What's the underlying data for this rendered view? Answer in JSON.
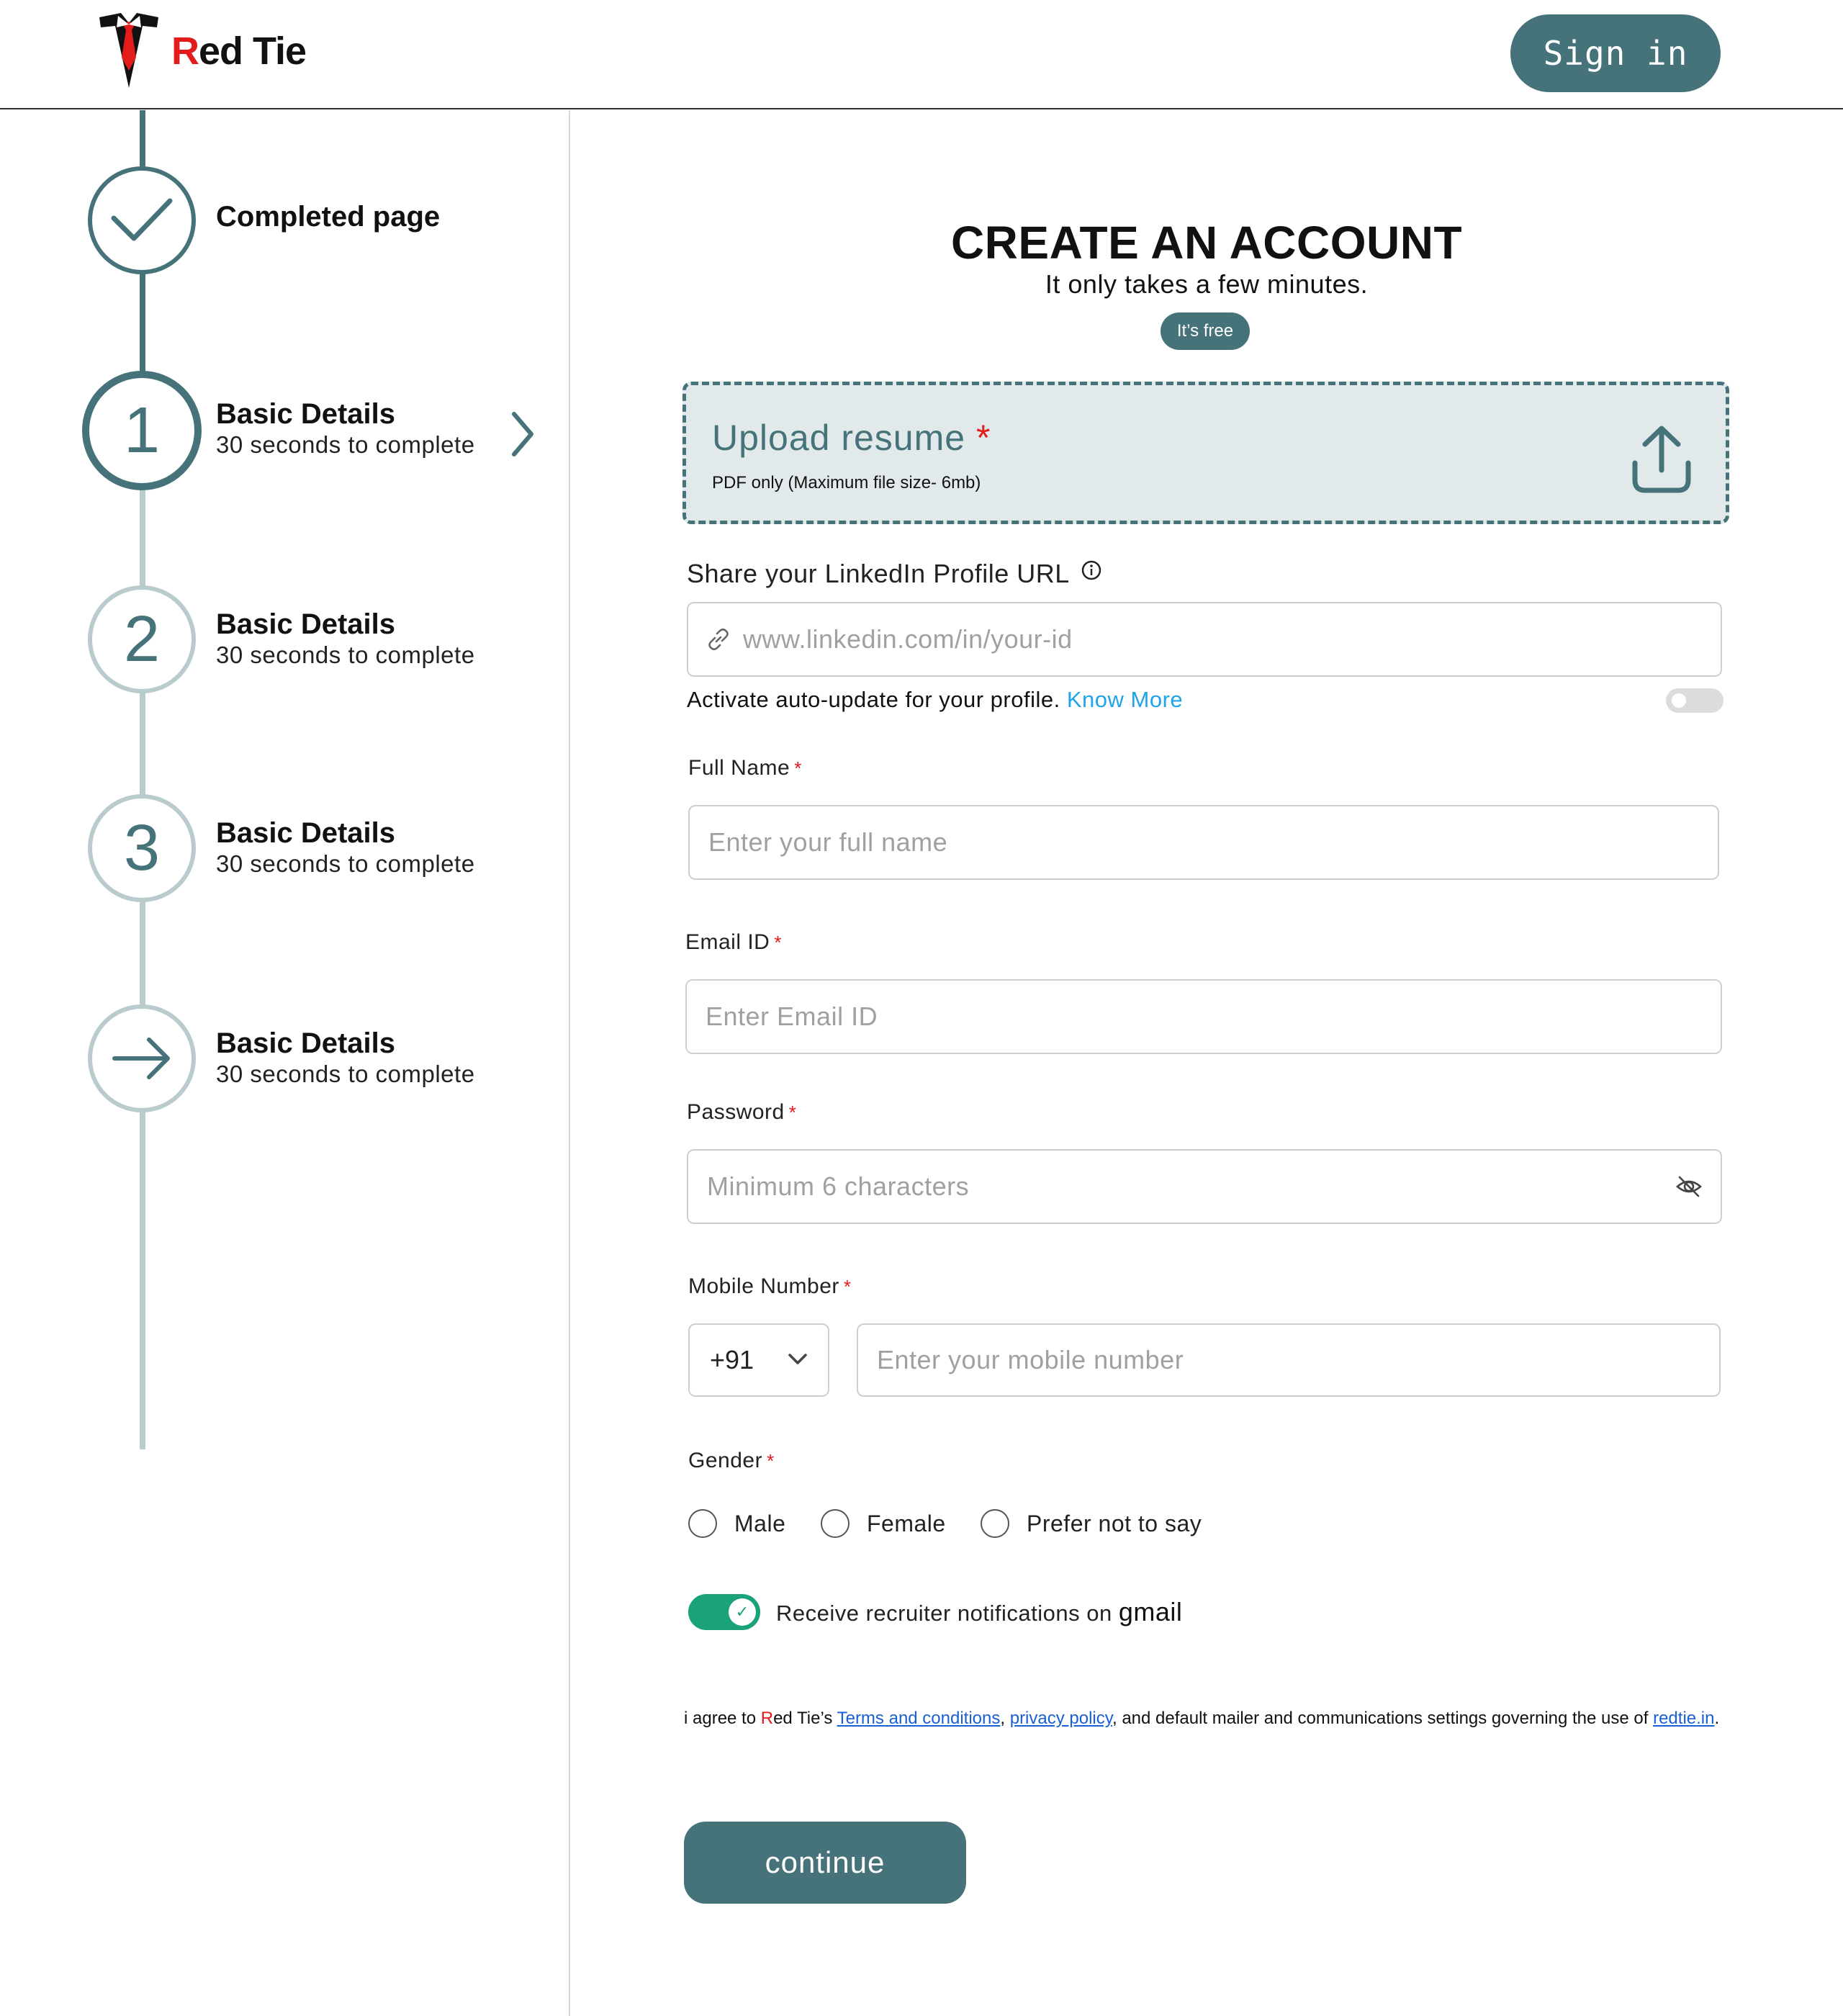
{
  "header": {
    "logo_text_accent": "R",
    "logo_text_rest": "ed Tie",
    "signin_label": "Sign in"
  },
  "sidebar": {
    "steps": [
      {
        "number": "",
        "icon": "check-icon",
        "title": "Completed page",
        "subtitle": "",
        "state": "completed"
      },
      {
        "number": "1",
        "icon": "",
        "title": "Basic Details",
        "subtitle": "30 seconds to complete",
        "state": "current"
      },
      {
        "number": "2",
        "icon": "",
        "title": "Basic Details",
        "subtitle": "30 seconds to complete",
        "state": "upcoming"
      },
      {
        "number": "3",
        "icon": "",
        "title": "Basic Details",
        "subtitle": "30 seconds to complete",
        "state": "upcoming"
      },
      {
        "number": "",
        "icon": "arrow-right-icon",
        "title": "Basic Details",
        "subtitle": "30 seconds to complete",
        "state": "upcoming"
      }
    ]
  },
  "main": {
    "title": "CREATE AN ACCOUNT",
    "subtitle": "It only takes a few minutes.",
    "free_badge": "It’s free",
    "upload": {
      "title": "Upload resume",
      "required_mark": "*",
      "note": "PDF only (Maximum file size- 6mb)"
    },
    "linkedin": {
      "label": "Share your LinkedIn Profile URL",
      "placeholder": "www.linkedin.com/in/your-id",
      "auto_update_text": "Activate auto-update for your profile.",
      "know_more": "Know More",
      "auto_update_enabled": false
    },
    "full_name": {
      "label": "Full Name",
      "required_mark": "*",
      "placeholder": "Enter your full name"
    },
    "email": {
      "label": "Email ID",
      "required_mark": "*",
      "placeholder": "Enter Email ID"
    },
    "password": {
      "label": "Password",
      "required_mark": "*",
      "placeholder": "Minimum 6 characters"
    },
    "mobile": {
      "label": "Mobile Number",
      "required_mark": "*",
      "country_code": "+91",
      "placeholder": "Enter your mobile number"
    },
    "gender": {
      "label": "Gender",
      "required_mark": "*",
      "options": [
        "Male",
        "Female",
        "Prefer not to say"
      ]
    },
    "notifications": {
      "text": "Receive recruiter notifications on",
      "text_emphasis": "gmail",
      "enabled": true,
      "check_glyph": "✓"
    },
    "agreement": {
      "prefix": "i agree to ",
      "brand_accent": "R",
      "brand_rest": "ed Tie’s ",
      "terms": "Terms and conditions",
      "comma": ", ",
      "privacy": "privacy policy",
      "middle": ", and default mailer and communications settings governing the use of ",
      "site": "redtie.in",
      "suffix": "."
    },
    "continue_label": "continue"
  },
  "colors": {
    "accent": "#46727a",
    "accent_light": "#b9cbcd",
    "required": "#e21b1b",
    "link": "#1ea4e8",
    "toggle_on": "#1aa37a"
  }
}
